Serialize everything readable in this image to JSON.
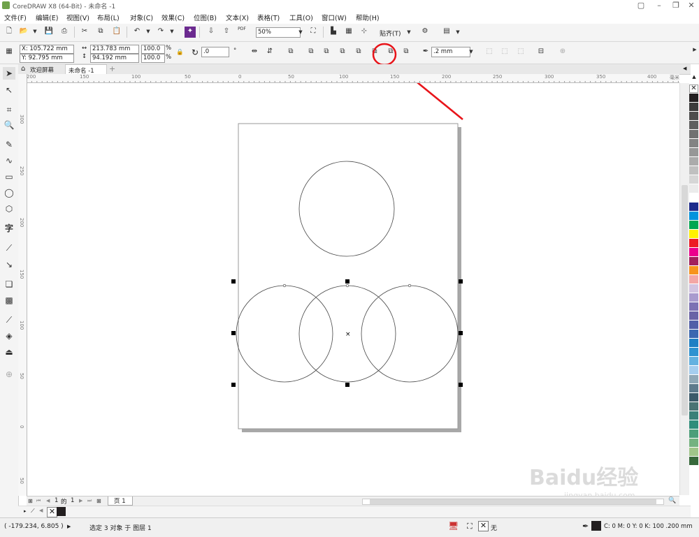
{
  "window": {
    "title": "CoreDRAW X8 (64-Bit) - 未命名 -1"
  },
  "menu": [
    "文件(F)",
    "编辑(E)",
    "视图(V)",
    "布局(L)",
    "对象(C)",
    "效果(C)",
    "位图(B)",
    "文本(X)",
    "表格(T)",
    "工具(O)",
    "窗口(W)",
    "帮助(H)"
  ],
  "toolbar": {
    "zoom": "50%",
    "pdf_label": "PDF",
    "snap_label": "贴齐(T)"
  },
  "property_bar": {
    "x": "X: 105.722 mm",
    "y": "Y: 92.795 mm",
    "width": "213.783 mm",
    "height": "94.192 mm",
    "scale_w": "100.0",
    "scale_h": "100.0",
    "pct": "%",
    "rotation": ".0",
    "outline": ".2 mm"
  },
  "tabs": {
    "welcome": "欢迎屏幕",
    "doc": "未命名 -1"
  },
  "ruler": {
    "h_ticks": [
      "200",
      "150",
      "100",
      "50",
      "0",
      "50",
      "100",
      "150",
      "200",
      "250",
      "300",
      "350",
      "400"
    ],
    "h_unit": "毫米",
    "v_ticks": [
      "300",
      "250",
      "200",
      "150",
      "100",
      "50",
      "0",
      "50"
    ]
  },
  "pager": {
    "current": "1",
    "of": "的",
    "total": "1",
    "page_tab": "页 1"
  },
  "status": {
    "coords": "( -179.234, 6.805 )",
    "selection": "选定 3 对象 于 图层 1",
    "fill_none": "无",
    "outline_info": "C: 0 M: 0 Y: 0 K: 100  .200 mm"
  },
  "watermark": {
    "line1": "Baidu经验",
    "line2": "jingyan.baidu.com"
  },
  "colors": {
    "annotation": "#e8141a",
    "accent": "#1a6fc4"
  },
  "palette": [
    "#231f20",
    "#3b3b3b",
    "#4d4d4d",
    "#5f5f5f",
    "#717171",
    "#838383",
    "#979797",
    "#ababab",
    "#c0c0c0",
    "#d6d6d6",
    "#ebebeb",
    "#ffffff",
    "#1d2a8c",
    "#0093dd",
    "#00a651",
    "#fff200",
    "#ed1c24",
    "#ec008c",
    "#a31f5c",
    "#f7941d",
    "#f3a7a6",
    "#d2c4e1",
    "#a99bce",
    "#7c71b4",
    "#6a62a6",
    "#525fa8",
    "#3a66b0",
    "#1f7fc4",
    "#2e92d1",
    "#64b1e0",
    "#a5cdee",
    "#8fa8b7",
    "#5d7a8c",
    "#3c5a6a",
    "#4a7374",
    "#3b8078",
    "#2f8d7a",
    "#4c9e79",
    "#74b280",
    "#a0c58a",
    "#37683b"
  ]
}
